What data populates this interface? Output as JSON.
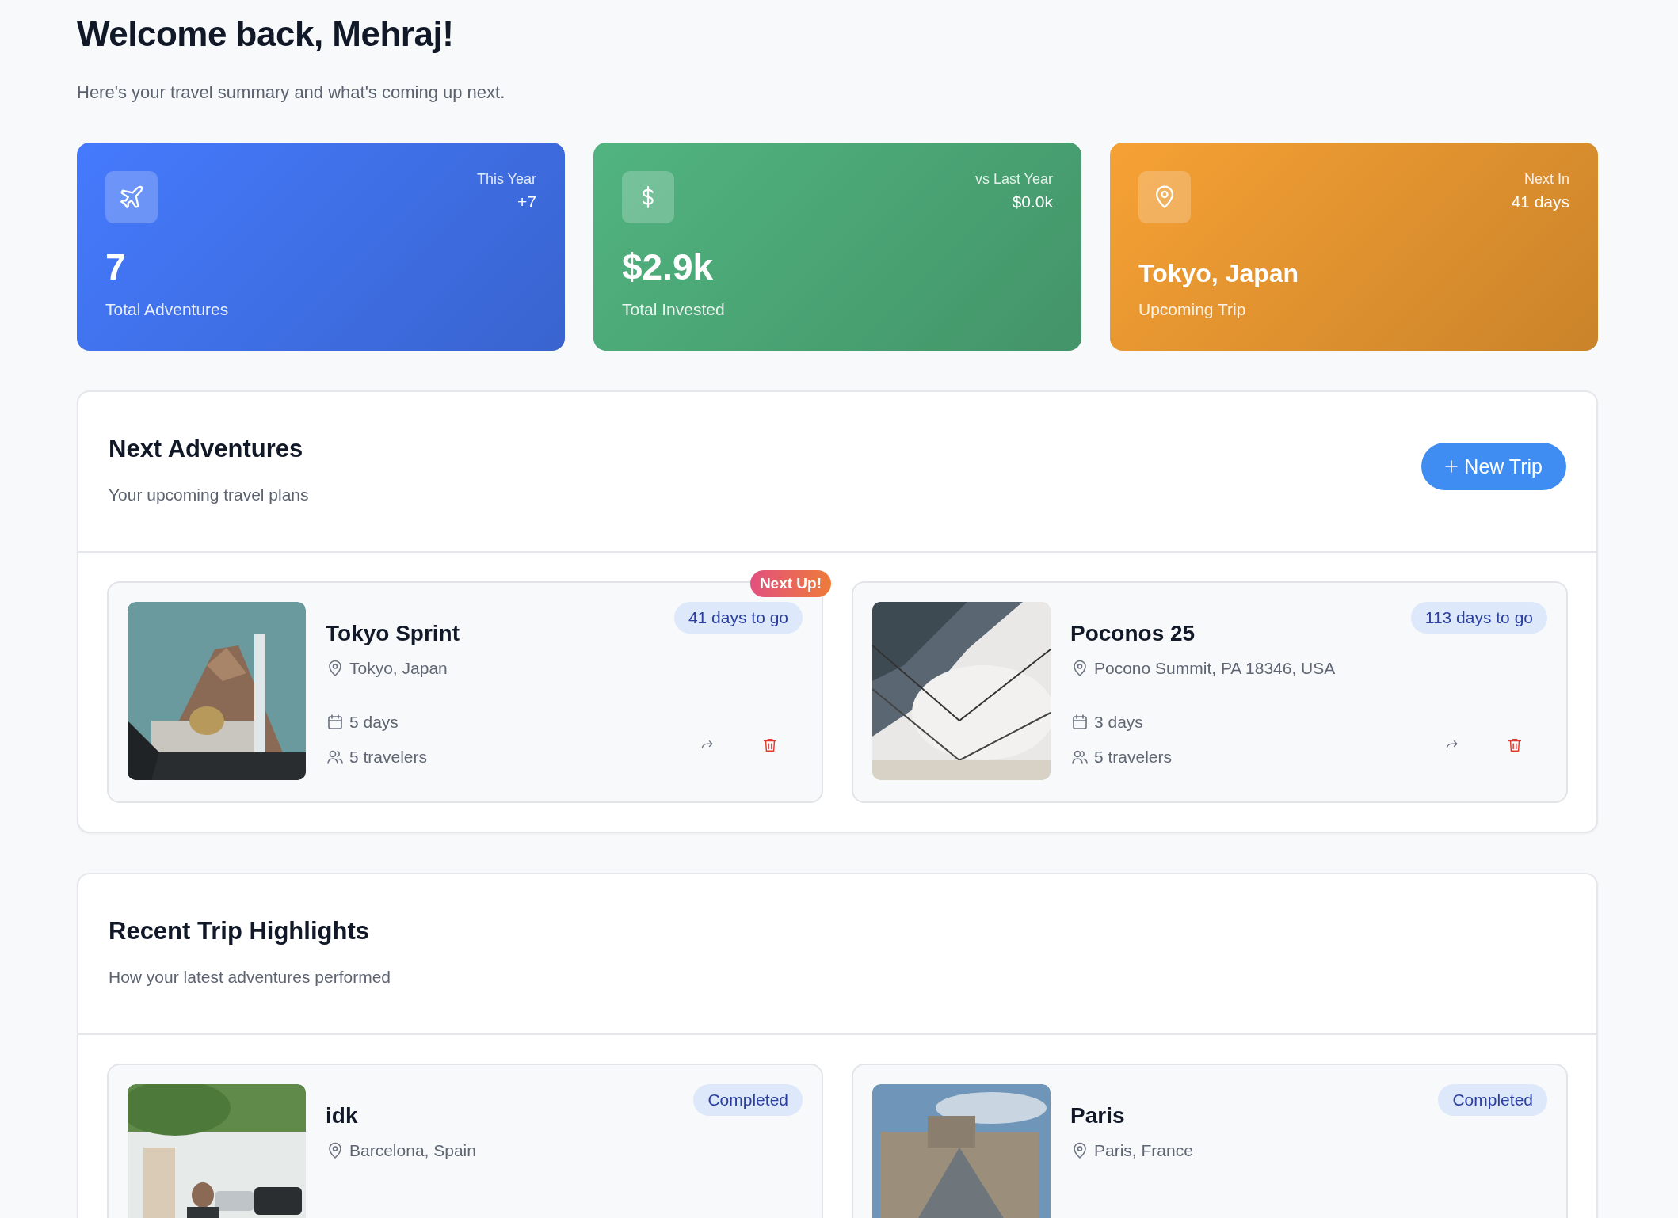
{
  "header": {
    "title": "Welcome back, Mehraj!",
    "subtitle": "Here's your travel summary and what's coming up next."
  },
  "stats": [
    {
      "kind": "plane",
      "color": "#3f6fe6",
      "corner_label": "This Year",
      "corner_value": "+7",
      "value": "7",
      "label": "Total Adventures"
    },
    {
      "kind": "dollar",
      "color": "#4aa474",
      "corner_label": "vs Last Year",
      "corner_value": "$0.0k",
      "value": "$2.9k",
      "label": "Total Invested"
    },
    {
      "kind": "pin",
      "color": "#e0922f",
      "corner_label": "Next In",
      "corner_value": "41 days",
      "value": "Tokyo, Japan",
      "label": "Upcoming Trip"
    }
  ],
  "sections": [
    {
      "title": "Next Adventures",
      "subtitle": "Your upcoming travel plans",
      "button": "New Trip",
      "trips": [
        {
          "kind": "upcoming",
          "title": "Tokyo Sprint",
          "location": "Tokyo, Japan",
          "badge": "41 days to go",
          "ribbon": "Next Up!",
          "duration": "5 days",
          "travelers": "5 travelers"
        },
        {
          "kind": "upcoming",
          "title": "Poconos 25",
          "location": "Pocono Summit, PA 18346, USA",
          "badge": "113 days to go",
          "duration": "3 days",
          "travelers": "5 travelers"
        }
      ]
    },
    {
      "title": "Recent Trip Highlights",
      "subtitle": "How your latest adventures performed",
      "trips": [
        {
          "kind": "completed",
          "title": "idk",
          "location": "Barcelona, Spain",
          "badge": "Completed"
        },
        {
          "kind": "completed",
          "title": "Paris",
          "location": "Paris, France",
          "badge": "Completed"
        }
      ]
    }
  ]
}
